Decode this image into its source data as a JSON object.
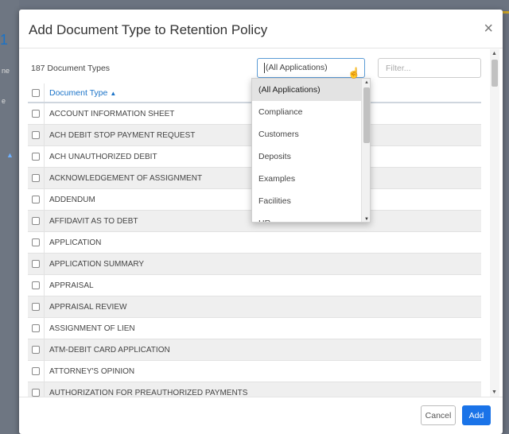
{
  "background": {
    "number_fragment": "1",
    "left_fragment_1": "ne",
    "left_fragment_2": "e"
  },
  "dialog": {
    "title": "Add Document Type to Retention Policy",
    "close_glyph": "×",
    "count_label": "187 Document Types",
    "application_select": {
      "value": "(All Applications)"
    },
    "filter": {
      "value": "",
      "placeholder": "Filter..."
    },
    "table": {
      "column_header": "Document Type",
      "sort_glyph": "▲",
      "rows": [
        "ACCOUNT INFORMATION SHEET",
        "ACH DEBIT STOP PAYMENT REQUEST",
        "ACH UNAUTHORIZED DEBIT",
        "ACKNOWLEDGEMENT OF ASSIGNMENT",
        "ADDENDUM",
        "AFFIDAVIT AS TO DEBT",
        "APPLICATION",
        "APPLICATION SUMMARY",
        "APPRAISAL",
        "APPRAISAL REVIEW",
        "ASSIGNMENT OF LIEN",
        "ATM-DEBIT CARD APPLICATION",
        "ATTORNEY'S OPINION",
        "AUTHORIZATION FOR PREAUTHORIZED PAYMENTS"
      ]
    },
    "dropdown_options": [
      "(All Applications)",
      "Compliance",
      "Customers",
      "Deposits",
      "Examples",
      "Facilities",
      "HR"
    ],
    "buttons": {
      "cancel": "Cancel",
      "add": "Add"
    }
  },
  "icons": {
    "close": "close-icon",
    "sort": "sort-ascending-icon",
    "cursor": "hand-pointer-icon"
  },
  "colors": {
    "accent": "#1a73e8",
    "link": "#1a73c8",
    "row_alt": "#efefef",
    "selected_option": "#e3e3e3"
  }
}
